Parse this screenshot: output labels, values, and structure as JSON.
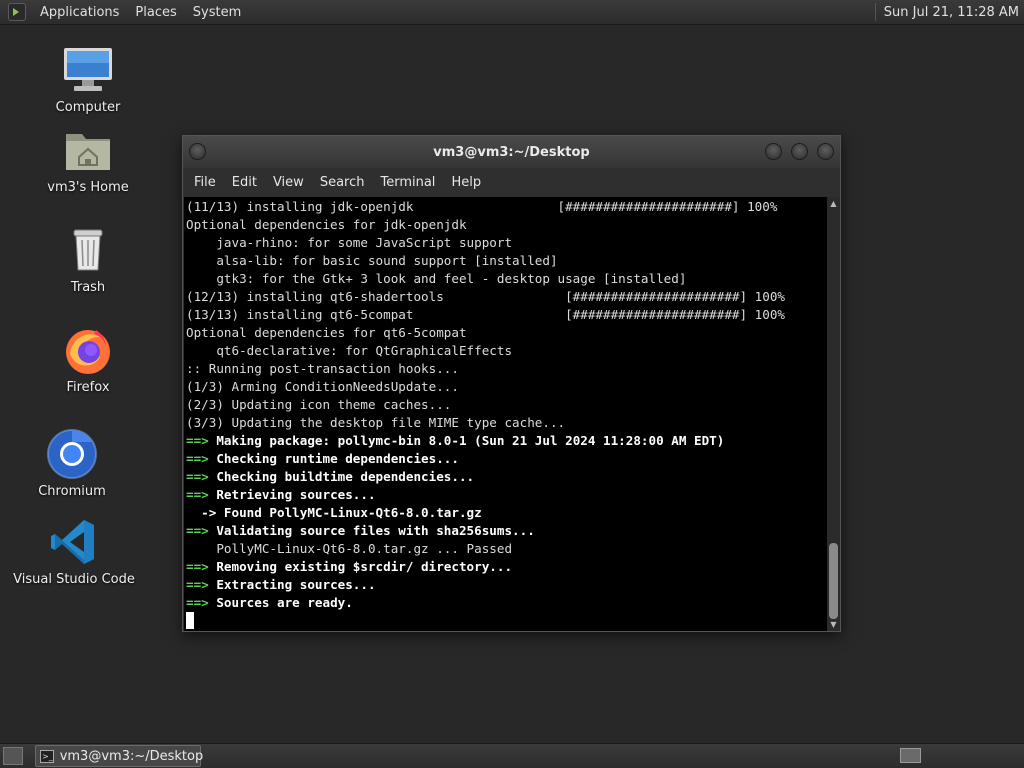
{
  "top_panel": {
    "menus": [
      "Applications",
      "Places",
      "System"
    ],
    "clock": "Sun Jul 21, 11:28 AM"
  },
  "desktop_icons": [
    {
      "label": "Computer",
      "icon": "computer-icon"
    },
    {
      "label": "vm3's Home",
      "icon": "home-folder-icon"
    },
    {
      "label": "Trash",
      "icon": "trash-icon"
    },
    {
      "label": "Firefox",
      "icon": "firefox-icon"
    },
    {
      "label": "Chromium",
      "icon": "chromium-icon"
    },
    {
      "label": "Visual Studio Code",
      "icon": "vscode-icon"
    }
  ],
  "terminal": {
    "title": "vm3@vm3:~/Desktop",
    "menus": [
      "File",
      "Edit",
      "View",
      "Search",
      "Terminal",
      "Help"
    ],
    "lines": [
      {
        "text": "(11/13) installing jdk-openjdk                   [######################] 100%"
      },
      {
        "text": "Optional dependencies for jdk-openjdk"
      },
      {
        "text": "    java-rhino: for some JavaScript support"
      },
      {
        "text": "    alsa-lib: for basic sound support [installed]"
      },
      {
        "text": "    gtk3: for the Gtk+ 3 look and feel - desktop usage [installed]"
      },
      {
        "text": "(12/13) installing qt6-shadertools                [######################] 100%"
      },
      {
        "text": "(13/13) installing qt6-5compat                    [######################] 100%"
      },
      {
        "text": "Optional dependencies for qt6-5compat"
      },
      {
        "text": "    qt6-declarative: for QtGraphicalEffects"
      },
      {
        "text": ":: Running post-transaction hooks..."
      },
      {
        "text": "(1/3) Arming ConditionNeedsUpdate..."
      },
      {
        "text": "(2/3) Updating icon theme caches..."
      },
      {
        "text": "(3/3) Updating the desktop file MIME type cache..."
      },
      {
        "prefix": "==>",
        "text": " Making package: pollymc-bin 8.0-1 (Sun 21 Jul 2024 11:28:00 AM EDT)",
        "bold": true
      },
      {
        "prefix": "==>",
        "text": " Checking runtime dependencies...",
        "bold": true
      },
      {
        "prefix": "==>",
        "text": " Checking buildtime dependencies...",
        "bold": true
      },
      {
        "prefix": "==>",
        "text": " Retrieving sources...",
        "bold": true
      },
      {
        "text": "  -> Found PollyMC-Linux-Qt6-8.0.tar.gz",
        "bold": true
      },
      {
        "prefix": "==>",
        "text": " Validating source files with sha256sums...",
        "bold": true
      },
      {
        "text": "    PollyMC-Linux-Qt6-8.0.tar.gz ... Passed"
      },
      {
        "prefix": "==>",
        "text": " Removing existing $srcdir/ directory...",
        "bold": true
      },
      {
        "prefix": "==>",
        "text": " Extracting sources...",
        "bold": true
      },
      {
        "prefix": "==>",
        "text": " Sources are ready.",
        "bold": true
      }
    ],
    "scroll_position": 0.85
  },
  "taskbar": {
    "tasks": [
      {
        "label": "vm3@vm3:~/Desktop",
        "icon": "terminal-icon"
      }
    ]
  },
  "colors": {
    "desktop_bg": "#282828",
    "terminal_bg": "#000000",
    "prompt_arrow": "#5bd35b",
    "firefox_orange": "#ff7139",
    "chromium_blue": "#4285f4",
    "vscode_blue": "#2489ca"
  }
}
